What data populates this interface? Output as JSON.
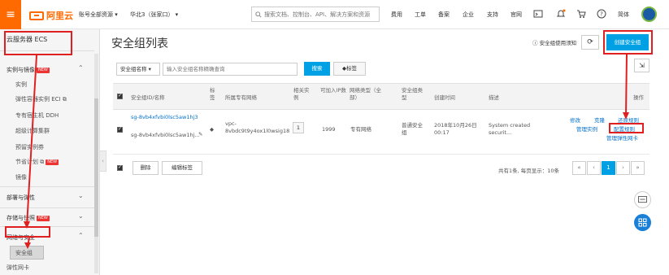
{
  "topbar": {
    "logo_text": "阿里云",
    "account_menu": "账号全部资源 ▾",
    "region_menu": "华北3（张家口） ▾",
    "search_placeholder": "搜索文档、控制台、API、解决方案和资源",
    "nav_items": [
      "费用",
      "工单",
      "备案",
      "企业",
      "支持",
      "官网"
    ],
    "lang": "简体"
  },
  "sidebar": {
    "title": "云服务器 ECS",
    "groups": [
      {
        "label": "实例与镜像",
        "badge": "NEW"
      },
      {
        "label": "部署与弹性"
      },
      {
        "label": "存储与快照",
        "badge": "NEW"
      },
      {
        "label": "网络与安全"
      }
    ],
    "sub_items_instances": [
      "实例",
      "弹性容器实例 ECI",
      "专有宿主机 DDH",
      "超级计算集群",
      "预留实例券",
      "节省计划",
      "镜像"
    ],
    "sub_items_network": [
      "安全组",
      "弹性网卡"
    ],
    "new_badge": "NEW"
  },
  "main": {
    "page_title": "安全组列表",
    "help_link": "安全组使用须知",
    "create_button": "创建安全组",
    "filter_select": "安全组名称",
    "filter_placeholder": "输入安全组名称精确查询",
    "search_button": "搜索",
    "tag_button": "标签",
    "columns": [
      "安全组ID/名称",
      "标签",
      "所属专有网络",
      "相关实例",
      "可加入IP数",
      "网络类型（全部）",
      "安全组类型",
      "创建时间",
      "描述",
      "操作"
    ],
    "row": {
      "id": "sg-8vb4xfvbi0lsc5aw1hj3",
      "name": "sg-8vb4xfvbi0lsc5aw1hj...",
      "vpc_prefix": "vpc-",
      "vpc_id": "8vbdc9t9y4ox1l0wsig18",
      "instances": "1",
      "ip_count": "1999",
      "network_type": "专有网络",
      "sg_type": "普通安全组",
      "created": "2018年10月26日 00:17",
      "description": "System created securit...",
      "actions": [
        "修改",
        "克隆",
        "还原规则",
        "管理实例",
        "配置规则",
        "管理弹性网卡"
      ]
    },
    "footer": {
      "delete_button": "删除",
      "edit_tags_button": "编辑标签",
      "pager_text": "共有1条, 每页显示：10条",
      "current_page": "1"
    }
  }
}
